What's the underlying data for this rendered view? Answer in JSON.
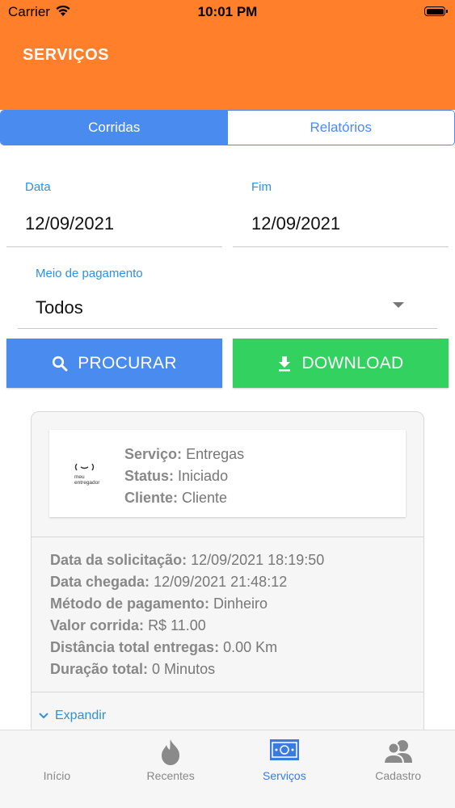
{
  "status_bar": {
    "carrier": "Carrier",
    "time": "10:01 PM"
  },
  "header": {
    "title": "SERVIÇOS",
    "color": "#ff7f2a"
  },
  "segments": {
    "rides": "Corridas",
    "reports": "Relatórios",
    "selected": "Corridas"
  },
  "form": {
    "start_label": "Data",
    "start_value": "12/09/2021",
    "end_label": "Fim",
    "end_value": "12/09/2021",
    "payment_label": "Meio de pagamento",
    "payment_value": "Todos"
  },
  "actions": {
    "search": "PROCURAR",
    "download": "DOWNLOAD",
    "search_color": "#4a8bf0",
    "download_color": "#33d160"
  },
  "card": {
    "logo_text_1": "meu",
    "logo_text_2": "entregador",
    "service_label": "Serviço:",
    "service_value": "Entregas",
    "status_label": "Status:",
    "status_value": "Iniciado",
    "client_label": "Cliente:",
    "client_value": "Cliente",
    "details": [
      {
        "label": "Data da solicitação:",
        "value": "12/09/2021 18:19:50"
      },
      {
        "label": "Data chegada:",
        "value": "12/09/2021 21:48:12"
      },
      {
        "label": "Método de pagamento:",
        "value": "Dinheiro"
      },
      {
        "label": "Valor corrida:",
        "value": "R$ 11.00"
      },
      {
        "label": "Distância total entregas:",
        "value": "0.00 Km"
      },
      {
        "label": "Duração total:",
        "value": "0 Minutos"
      }
    ],
    "expand": "Expandir"
  },
  "tabbar": {
    "items": [
      {
        "label": "Início",
        "icon": "home-icon"
      },
      {
        "label": "Recentes",
        "icon": "flame-icon"
      },
      {
        "label": "Serviços",
        "icon": "money-icon"
      },
      {
        "label": "Cadastro",
        "icon": "users-icon"
      }
    ],
    "selected": "Serviços"
  }
}
